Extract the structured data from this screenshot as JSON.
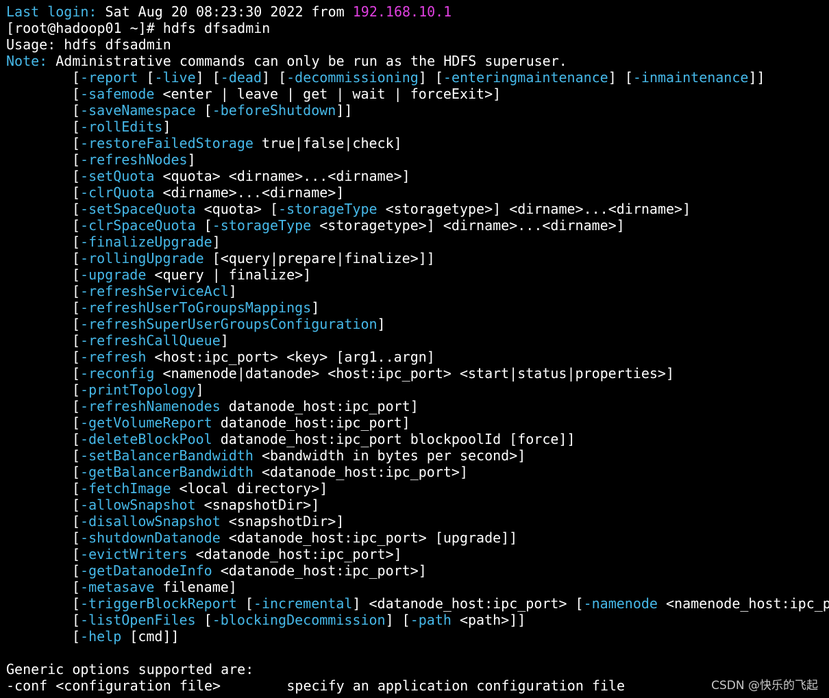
{
  "colors": {
    "background": "#000000",
    "text": "#ffffff",
    "option": "#46b8e8",
    "host": "#e040e0",
    "watermark": "#c8c8c8"
  },
  "header_lines": [
    [
      {
        "text": "Last login:",
        "color": "blue"
      },
      {
        "text": " Sat Aug 20 08:23:30 2022 from ",
        "color": "white"
      },
      {
        "text": "192.168.10.1",
        "color": "magenta"
      }
    ],
    [
      {
        "text": "[root@hadoop01 ~]# hdfs dfsadmin",
        "color": "white"
      }
    ],
    [
      {
        "text": "Usage: hdfs dfsadmin",
        "color": "white"
      }
    ],
    [
      {
        "text": "Note:",
        "color": "blue"
      },
      {
        "text": " Administrative commands can only be run as the HDFS superuser.",
        "color": "white"
      }
    ]
  ],
  "option_lines": [
    [
      {
        "text": "[",
        "color": "white"
      },
      {
        "text": "-report",
        "color": "blue"
      },
      {
        "text": " [",
        "color": "white"
      },
      {
        "text": "-live",
        "color": "blue"
      },
      {
        "text": "] [",
        "color": "white"
      },
      {
        "text": "-dead",
        "color": "blue"
      },
      {
        "text": "] [",
        "color": "white"
      },
      {
        "text": "-decommissioning",
        "color": "blue"
      },
      {
        "text": "] [",
        "color": "white"
      },
      {
        "text": "-enteringmaintenance",
        "color": "blue"
      },
      {
        "text": "] [",
        "color": "white"
      },
      {
        "text": "-inmaintenance",
        "color": "blue"
      },
      {
        "text": "]]",
        "color": "white"
      }
    ],
    [
      {
        "text": "[",
        "color": "white"
      },
      {
        "text": "-safemode",
        "color": "blue"
      },
      {
        "text": " <enter | leave | get | wait | forceExit>]",
        "color": "white"
      }
    ],
    [
      {
        "text": "[",
        "color": "white"
      },
      {
        "text": "-saveNamespace",
        "color": "blue"
      },
      {
        "text": " [",
        "color": "white"
      },
      {
        "text": "-beforeShutdown",
        "color": "blue"
      },
      {
        "text": "]]",
        "color": "white"
      }
    ],
    [
      {
        "text": "[",
        "color": "white"
      },
      {
        "text": "-rollEdits",
        "color": "blue"
      },
      {
        "text": "]",
        "color": "white"
      }
    ],
    [
      {
        "text": "[",
        "color": "white"
      },
      {
        "text": "-restoreFailedStorage",
        "color": "blue"
      },
      {
        "text": " true|false|check]",
        "color": "white"
      }
    ],
    [
      {
        "text": "[",
        "color": "white"
      },
      {
        "text": "-refreshNodes",
        "color": "blue"
      },
      {
        "text": "]",
        "color": "white"
      }
    ],
    [
      {
        "text": "[",
        "color": "white"
      },
      {
        "text": "-setQuota",
        "color": "blue"
      },
      {
        "text": " <quota> <dirname>...<dirname>]",
        "color": "white"
      }
    ],
    [
      {
        "text": "[",
        "color": "white"
      },
      {
        "text": "-clrQuota",
        "color": "blue"
      },
      {
        "text": " <dirname>...<dirname>]",
        "color": "white"
      }
    ],
    [
      {
        "text": "[",
        "color": "white"
      },
      {
        "text": "-setSpaceQuota",
        "color": "blue"
      },
      {
        "text": " <quota> [",
        "color": "white"
      },
      {
        "text": "-storageType",
        "color": "blue"
      },
      {
        "text": " <storagetype>] <dirname>...<dirname>]",
        "color": "white"
      }
    ],
    [
      {
        "text": "[",
        "color": "white"
      },
      {
        "text": "-clrSpaceQuota",
        "color": "blue"
      },
      {
        "text": " [",
        "color": "white"
      },
      {
        "text": "-storageType",
        "color": "blue"
      },
      {
        "text": " <storagetype>] <dirname>...<dirname>]",
        "color": "white"
      }
    ],
    [
      {
        "text": "[",
        "color": "white"
      },
      {
        "text": "-finalizeUpgrade",
        "color": "blue"
      },
      {
        "text": "]",
        "color": "white"
      }
    ],
    [
      {
        "text": "[",
        "color": "white"
      },
      {
        "text": "-rollingUpgrade",
        "color": "blue"
      },
      {
        "text": " [<query|prepare|finalize>]]",
        "color": "white"
      }
    ],
    [
      {
        "text": "[",
        "color": "white"
      },
      {
        "text": "-upgrade",
        "color": "blue"
      },
      {
        "text": " <query | finalize>]",
        "color": "white"
      }
    ],
    [
      {
        "text": "[",
        "color": "white"
      },
      {
        "text": "-refreshServiceAcl",
        "color": "blue"
      },
      {
        "text": "]",
        "color": "white"
      }
    ],
    [
      {
        "text": "[",
        "color": "white"
      },
      {
        "text": "-refreshUserToGroupsMappings",
        "color": "blue"
      },
      {
        "text": "]",
        "color": "white"
      }
    ],
    [
      {
        "text": "[",
        "color": "white"
      },
      {
        "text": "-refreshSuperUserGroupsConfiguration",
        "color": "blue"
      },
      {
        "text": "]",
        "color": "white"
      }
    ],
    [
      {
        "text": "[",
        "color": "white"
      },
      {
        "text": "-refreshCallQueue",
        "color": "blue"
      },
      {
        "text": "]",
        "color": "white"
      }
    ],
    [
      {
        "text": "[",
        "color": "white"
      },
      {
        "text": "-refresh",
        "color": "blue"
      },
      {
        "text": " <host:ipc_port> <key> [arg1..argn]",
        "color": "white"
      }
    ],
    [
      {
        "text": "[",
        "color": "white"
      },
      {
        "text": "-reconfig",
        "color": "blue"
      },
      {
        "text": " <namenode|datanode> <host:ipc_port> <start|status|properties>]",
        "color": "white"
      }
    ],
    [
      {
        "text": "[",
        "color": "white"
      },
      {
        "text": "-printTopology",
        "color": "blue"
      },
      {
        "text": "]",
        "color": "white"
      }
    ],
    [
      {
        "text": "[",
        "color": "white"
      },
      {
        "text": "-refreshNamenodes",
        "color": "blue"
      },
      {
        "text": " datanode_host:ipc_port]",
        "color": "white"
      }
    ],
    [
      {
        "text": "[",
        "color": "white"
      },
      {
        "text": "-getVolumeReport",
        "color": "blue"
      },
      {
        "text": " datanode_host:ipc_port]",
        "color": "white"
      }
    ],
    [
      {
        "text": "[",
        "color": "white"
      },
      {
        "text": "-deleteBlockPool",
        "color": "blue"
      },
      {
        "text": " datanode_host:ipc_port blockpoolId [force]]",
        "color": "white"
      }
    ],
    [
      {
        "text": "[",
        "color": "white"
      },
      {
        "text": "-setBalancerBandwidth",
        "color": "blue"
      },
      {
        "text": " <bandwidth in bytes per second>]",
        "color": "white"
      }
    ],
    [
      {
        "text": "[",
        "color": "white"
      },
      {
        "text": "-getBalancerBandwidth",
        "color": "blue"
      },
      {
        "text": " <datanode_host:ipc_port>]",
        "color": "white"
      }
    ],
    [
      {
        "text": "[",
        "color": "white"
      },
      {
        "text": "-fetchImage",
        "color": "blue"
      },
      {
        "text": " <local directory>]",
        "color": "white"
      }
    ],
    [
      {
        "text": "[",
        "color": "white"
      },
      {
        "text": "-allowSnapshot",
        "color": "blue"
      },
      {
        "text": " <snapshotDir>]",
        "color": "white"
      }
    ],
    [
      {
        "text": "[",
        "color": "white"
      },
      {
        "text": "-disallowSnapshot",
        "color": "blue"
      },
      {
        "text": " <snapshotDir>]",
        "color": "white"
      }
    ],
    [
      {
        "text": "[",
        "color": "white"
      },
      {
        "text": "-shutdownDatanode",
        "color": "blue"
      },
      {
        "text": " <datanode_host:ipc_port> [upgrade]]",
        "color": "white"
      }
    ],
    [
      {
        "text": "[",
        "color": "white"
      },
      {
        "text": "-evictWriters",
        "color": "blue"
      },
      {
        "text": " <datanode_host:ipc_port>]",
        "color": "white"
      }
    ],
    [
      {
        "text": "[",
        "color": "white"
      },
      {
        "text": "-getDatanodeInfo",
        "color": "blue"
      },
      {
        "text": " <datanode_host:ipc_port>]",
        "color": "white"
      }
    ],
    [
      {
        "text": "[",
        "color": "white"
      },
      {
        "text": "-metasave",
        "color": "blue"
      },
      {
        "text": " filename]",
        "color": "white"
      }
    ],
    [
      {
        "text": "[",
        "color": "white"
      },
      {
        "text": "-triggerBlockReport",
        "color": "blue"
      },
      {
        "text": " [",
        "color": "white"
      },
      {
        "text": "-incremental",
        "color": "blue"
      },
      {
        "text": "] <datanode_host:ipc_port> [",
        "color": "white"
      },
      {
        "text": "-namenode",
        "color": "blue"
      },
      {
        "text": " <namenode_host:ipc_p",
        "color": "white"
      }
    ],
    [
      {
        "text": "[",
        "color": "white"
      },
      {
        "text": "-listOpenFiles",
        "color": "blue"
      },
      {
        "text": " [",
        "color": "white"
      },
      {
        "text": "-blockingDecommission",
        "color": "blue"
      },
      {
        "text": "] [",
        "color": "white"
      },
      {
        "text": "-path",
        "color": "blue"
      },
      {
        "text": " <path>]]",
        "color": "white"
      }
    ],
    [
      {
        "text": "[",
        "color": "white"
      },
      {
        "text": "-help",
        "color": "blue"
      },
      {
        "text": " [cmd]]",
        "color": "white"
      }
    ]
  ],
  "footer_lines": [
    [
      {
        "text": "",
        "color": "white"
      }
    ],
    [
      {
        "text": "Generic options supported are:",
        "color": "white"
      }
    ],
    [
      {
        "text": "-conf <configuration file>        specify an application configuration file",
        "color": "white"
      }
    ]
  ],
  "watermark": "CSDN @快乐的飞起"
}
